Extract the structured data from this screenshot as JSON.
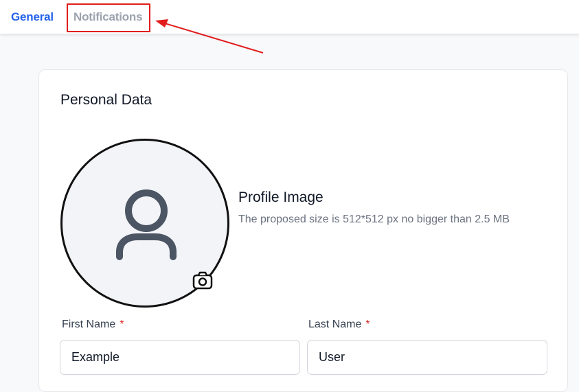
{
  "tabs": [
    {
      "label": "General",
      "active": true
    },
    {
      "label": "Notifications",
      "active": false
    }
  ],
  "colors": {
    "active_tab": "#2563eb",
    "inactive_tab": "#9ca3af",
    "annotation": "#e11d1d",
    "required": "#dc2626"
  },
  "section": {
    "title": "Personal Data"
  },
  "profile_image": {
    "title": "Profile Image",
    "description": "The proposed size is 512*512 px no bigger than 2.5 MB",
    "avatar_icon": "user-icon",
    "upload_icon": "camera-icon"
  },
  "form": {
    "first_name": {
      "label": "First Name",
      "required_mark": "*",
      "value": "Example"
    },
    "last_name": {
      "label": "Last Name",
      "required_mark": "*",
      "value": "User"
    }
  }
}
